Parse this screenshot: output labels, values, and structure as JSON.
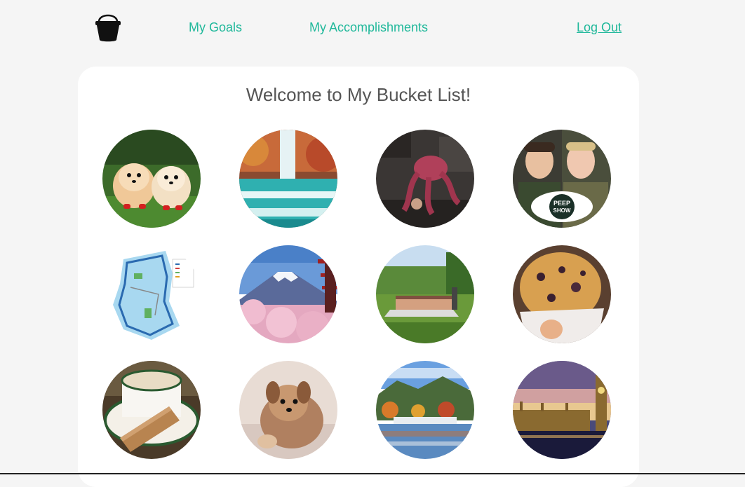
{
  "nav": {
    "logo_icon": "bucket-icon",
    "goals_label": "My Goals",
    "accomplishments_label": "My Accomplishments",
    "logout_label": "Log Out",
    "link_color": "#1fb89a"
  },
  "main": {
    "title": "Welcome to My Bucket List!",
    "goals": [
      {
        "picture": "two pomeranian dogs on grass"
      },
      {
        "picture": "turquoise waterfall with autumn trees"
      },
      {
        "picture": "octopus on rocks"
      },
      {
        "picture": "two men with peep show logo",
        "logo_text": "PEEP SHOW"
      },
      {
        "picture": "trail map"
      },
      {
        "picture": "mount fuji with cherry blossoms and pagoda"
      },
      {
        "picture": "airboat in swamp"
      },
      {
        "picture": "blueberry muffin in paper"
      },
      {
        "picture": "cappuccino cup with biscotti"
      },
      {
        "picture": "small yorkie puppy on bed"
      },
      {
        "picture": "autumn mountains over lake town"
      },
      {
        "picture": "big ben and parliament at dusk"
      }
    ]
  }
}
